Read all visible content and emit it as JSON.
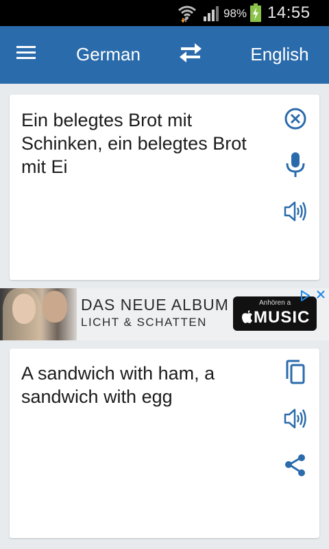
{
  "status_bar": {
    "battery_percent": "98%",
    "time": "14:55",
    "icons": [
      "wifi-icon",
      "signal-icon",
      "battery-charging-icon"
    ]
  },
  "app_bar": {
    "source_language": "German",
    "target_language": "English",
    "icons": [
      "menu-icon",
      "swap-languages-icon"
    ],
    "background_color": "#2a6bab"
  },
  "input_card": {
    "text": "Ein belegtes Brot mit Schinken, ein belegtes Brot mit Ei",
    "icons": [
      "clear-icon",
      "microphone-icon",
      "speaker-icon"
    ]
  },
  "ad_banner": {
    "line1": "DAS NEUE ALBUM",
    "line2": "LICHT & SCHATTEN",
    "badge_top": "Anhören a",
    "badge_main": "MUSIC",
    "icons": [
      "ad-choices-icon",
      "close-icon",
      "apple-logo-icon"
    ]
  },
  "output_card": {
    "text": "A sandwich with ham, a sandwich with egg",
    "icons": [
      "copy-icon",
      "speaker-icon",
      "share-icon"
    ]
  },
  "accent_color": "#2a6bab"
}
